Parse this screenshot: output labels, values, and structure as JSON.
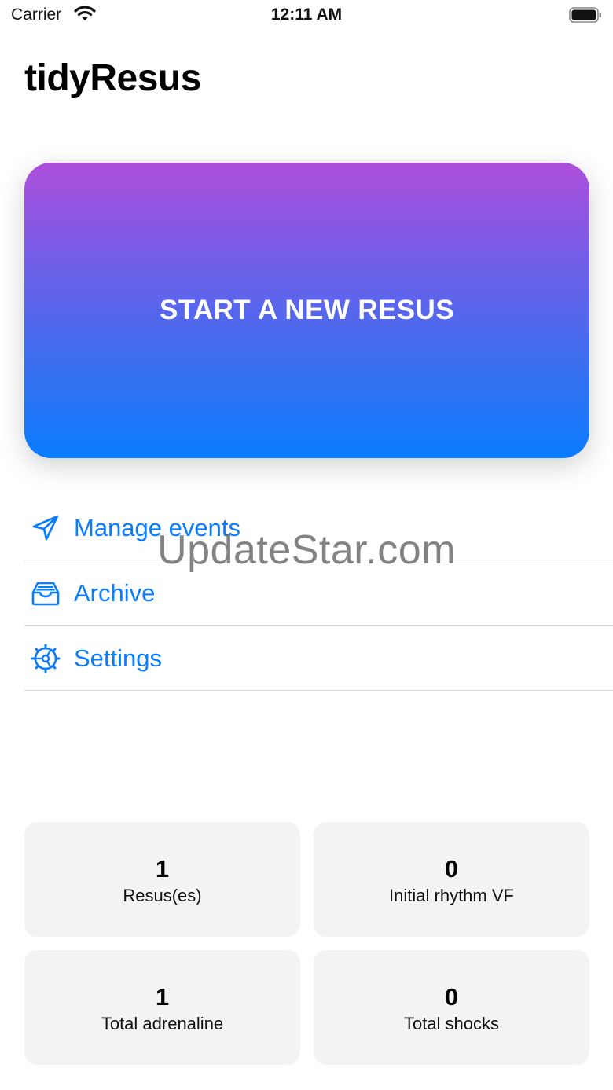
{
  "status_bar": {
    "carrier": "Carrier",
    "time": "12:11 AM",
    "wifi_icon": "wifi-icon",
    "battery_icon": "battery-icon"
  },
  "app": {
    "title": "tidyResus"
  },
  "start_button": {
    "label": "START A NEW RESUS",
    "gradient_top": "#ad4edb",
    "gradient_bottom": "#0a7cfe"
  },
  "menu": {
    "accent": "#0a7cfe",
    "items": [
      {
        "label": "Manage events",
        "icon": "paper-plane-icon"
      },
      {
        "label": "Archive",
        "icon": "tray-icon"
      },
      {
        "label": "Settings",
        "icon": "gear-icon"
      }
    ]
  },
  "watermark": "UpdateStar.com",
  "stats": [
    {
      "value": "1",
      "label": "Resus(es)"
    },
    {
      "value": "0",
      "label": "Initial rhythm VF"
    },
    {
      "value": "1",
      "label": "Total adrenaline"
    },
    {
      "value": "0",
      "label": "Total shocks"
    }
  ]
}
